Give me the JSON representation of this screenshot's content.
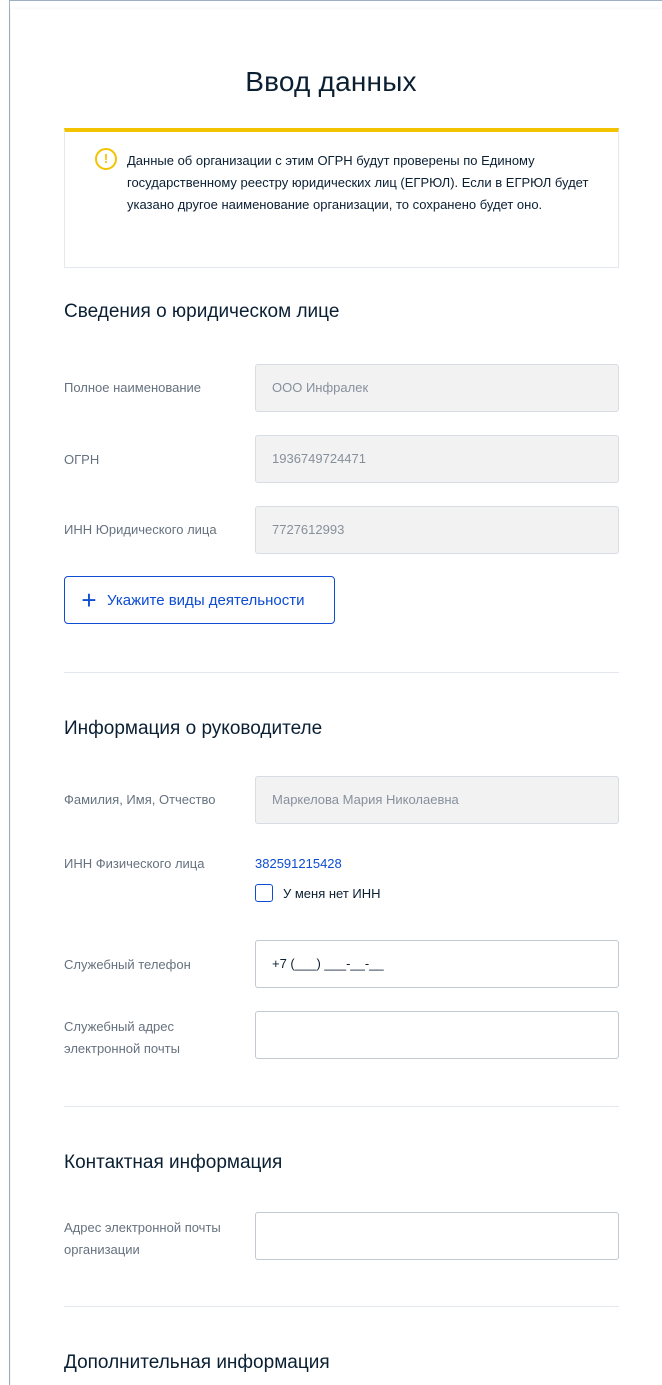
{
  "page": {
    "title": "Ввод данных"
  },
  "notice": {
    "icon": "!",
    "text": "Данные об организации с этим ОГРН будут проверены по Единому государственному реестру юридических лиц (ЕГРЮЛ). Если в ЕГРЮЛ будет указано другое наименование организации, то сохранено будет оно."
  },
  "legal_entity": {
    "section_title": "Сведения о юридическом лице",
    "full_name_label": "Полное наименование",
    "full_name_value": "ООО Инфралек",
    "ogrn_label": "ОГРН",
    "ogrn_value": "1936749724471",
    "inn_label": "ИНН Юридического лица",
    "inn_value": "7727612993",
    "add_activities_label": "Укажите виды деятельности"
  },
  "head": {
    "section_title": "Информация о руководителе",
    "fio_label": "Фамилия, Имя, Отчество",
    "fio_value": "Маркелова Мария Николаевна",
    "inn_label": "ИНН Физического лица",
    "inn_value": "382591215428",
    "no_inn_label": "У меня нет ИНН",
    "phone_label": "Служебный телефон",
    "phone_value": "+7 (___) ___-__-__",
    "email_label_1": "Служебный адрес",
    "email_label_2": "электронной почты",
    "email_value": ""
  },
  "contact": {
    "section_title": "Контактная информация",
    "org_email_label_1": "Адрес электронной почты",
    "org_email_label_2": "организации",
    "org_email_value": ""
  },
  "additional": {
    "section_title": "Дополнительная информация"
  },
  "colors": {
    "accent": "#0d4cd3",
    "warning": "#f3c300",
    "text": "#0b1f33",
    "muted": "#66727f"
  }
}
